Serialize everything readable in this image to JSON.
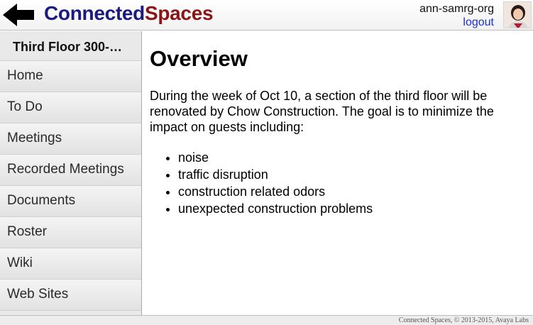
{
  "header": {
    "brand_part1": "Connected",
    "brand_part2": "Spaces",
    "username": "ann-samrg-org",
    "logout_label": "logout",
    "back_icon": "back-arrow-icon",
    "colors": {
      "brand_blue": "#1a1a80",
      "brand_red": "#8b1414",
      "link_blue": "#1a2fd8"
    }
  },
  "sidebar": {
    "space_title": "Third Floor 300-…",
    "items": [
      {
        "label": "Home"
      },
      {
        "label": "To Do"
      },
      {
        "label": "Meetings"
      },
      {
        "label": "Recorded Meetings"
      },
      {
        "label": "Documents"
      },
      {
        "label": "Roster"
      },
      {
        "label": "Wiki"
      },
      {
        "label": "Web Sites"
      }
    ]
  },
  "main": {
    "heading": "Overview",
    "paragraph": "During the week of Oct 10, a section of the third floor will be renovated by Chow Construction. The goal is to minimize the impact on guests including:",
    "bullets": [
      "noise",
      "traffic disruption",
      "construction related odors",
      "unexpected construction problems"
    ]
  },
  "footer": {
    "text": "Connected Spaces, © 2013-2015, Avaya Labs"
  }
}
